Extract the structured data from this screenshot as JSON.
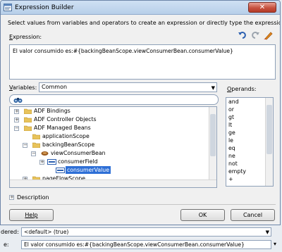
{
  "window": {
    "title": "Expression Builder",
    "close_glyph": "✕"
  },
  "instruction": "Select values from variables and operators to create an expression or directly type the expression here:",
  "expression": {
    "label": "Expression:",
    "value": "El valor consumido es:#{backingBeanScope.viewConsumerBean.consumerValue}",
    "toolbar_icons": [
      "undo-icon",
      "redo-icon",
      "clear-icon"
    ]
  },
  "variables": {
    "label": "Variables:",
    "selected": "Common",
    "search_icon": "binoculars-icon",
    "tree": [
      {
        "label": "ADF Bindings",
        "expanded": false,
        "icon": "folder-icon"
      },
      {
        "label": "ADF Controller Objects",
        "expanded": false,
        "icon": "folder-icon"
      },
      {
        "label": "ADF Managed Beans",
        "expanded": true,
        "icon": "folder-icon"
      },
      {
        "label": "applicationScope",
        "expanded": false,
        "icon": "folder-icon"
      },
      {
        "label": "backingBeanScope",
        "expanded": true,
        "icon": "folder-icon"
      },
      {
        "label": "viewConsumerBean",
        "expanded": true,
        "icon": "bean-icon"
      },
      {
        "label": "consumerField",
        "expanded": false,
        "icon": "field-icon"
      },
      {
        "label": "consumerValue",
        "expanded": false,
        "icon": "field-icon",
        "selected": true
      },
      {
        "label": "pageFlowScope",
        "expanded": false,
        "icon": "folder-icon"
      }
    ]
  },
  "operands": {
    "label": "Operands:",
    "items": [
      "and",
      "or",
      "gt",
      "lt",
      "ge",
      "le",
      "eq",
      "ne",
      "not",
      "empty",
      "+"
    ]
  },
  "description": {
    "label": "Description"
  },
  "buttons": {
    "help": "Help",
    "ok": "OK",
    "cancel": "Cancel"
  },
  "background": {
    "rendered_label": "dered:",
    "rendered_value": "<default> (true)",
    "value_label": "e:",
    "value_text": "El valor consumido es:#{backingBeanScope.viewConsumerBean.consumerValue}"
  }
}
